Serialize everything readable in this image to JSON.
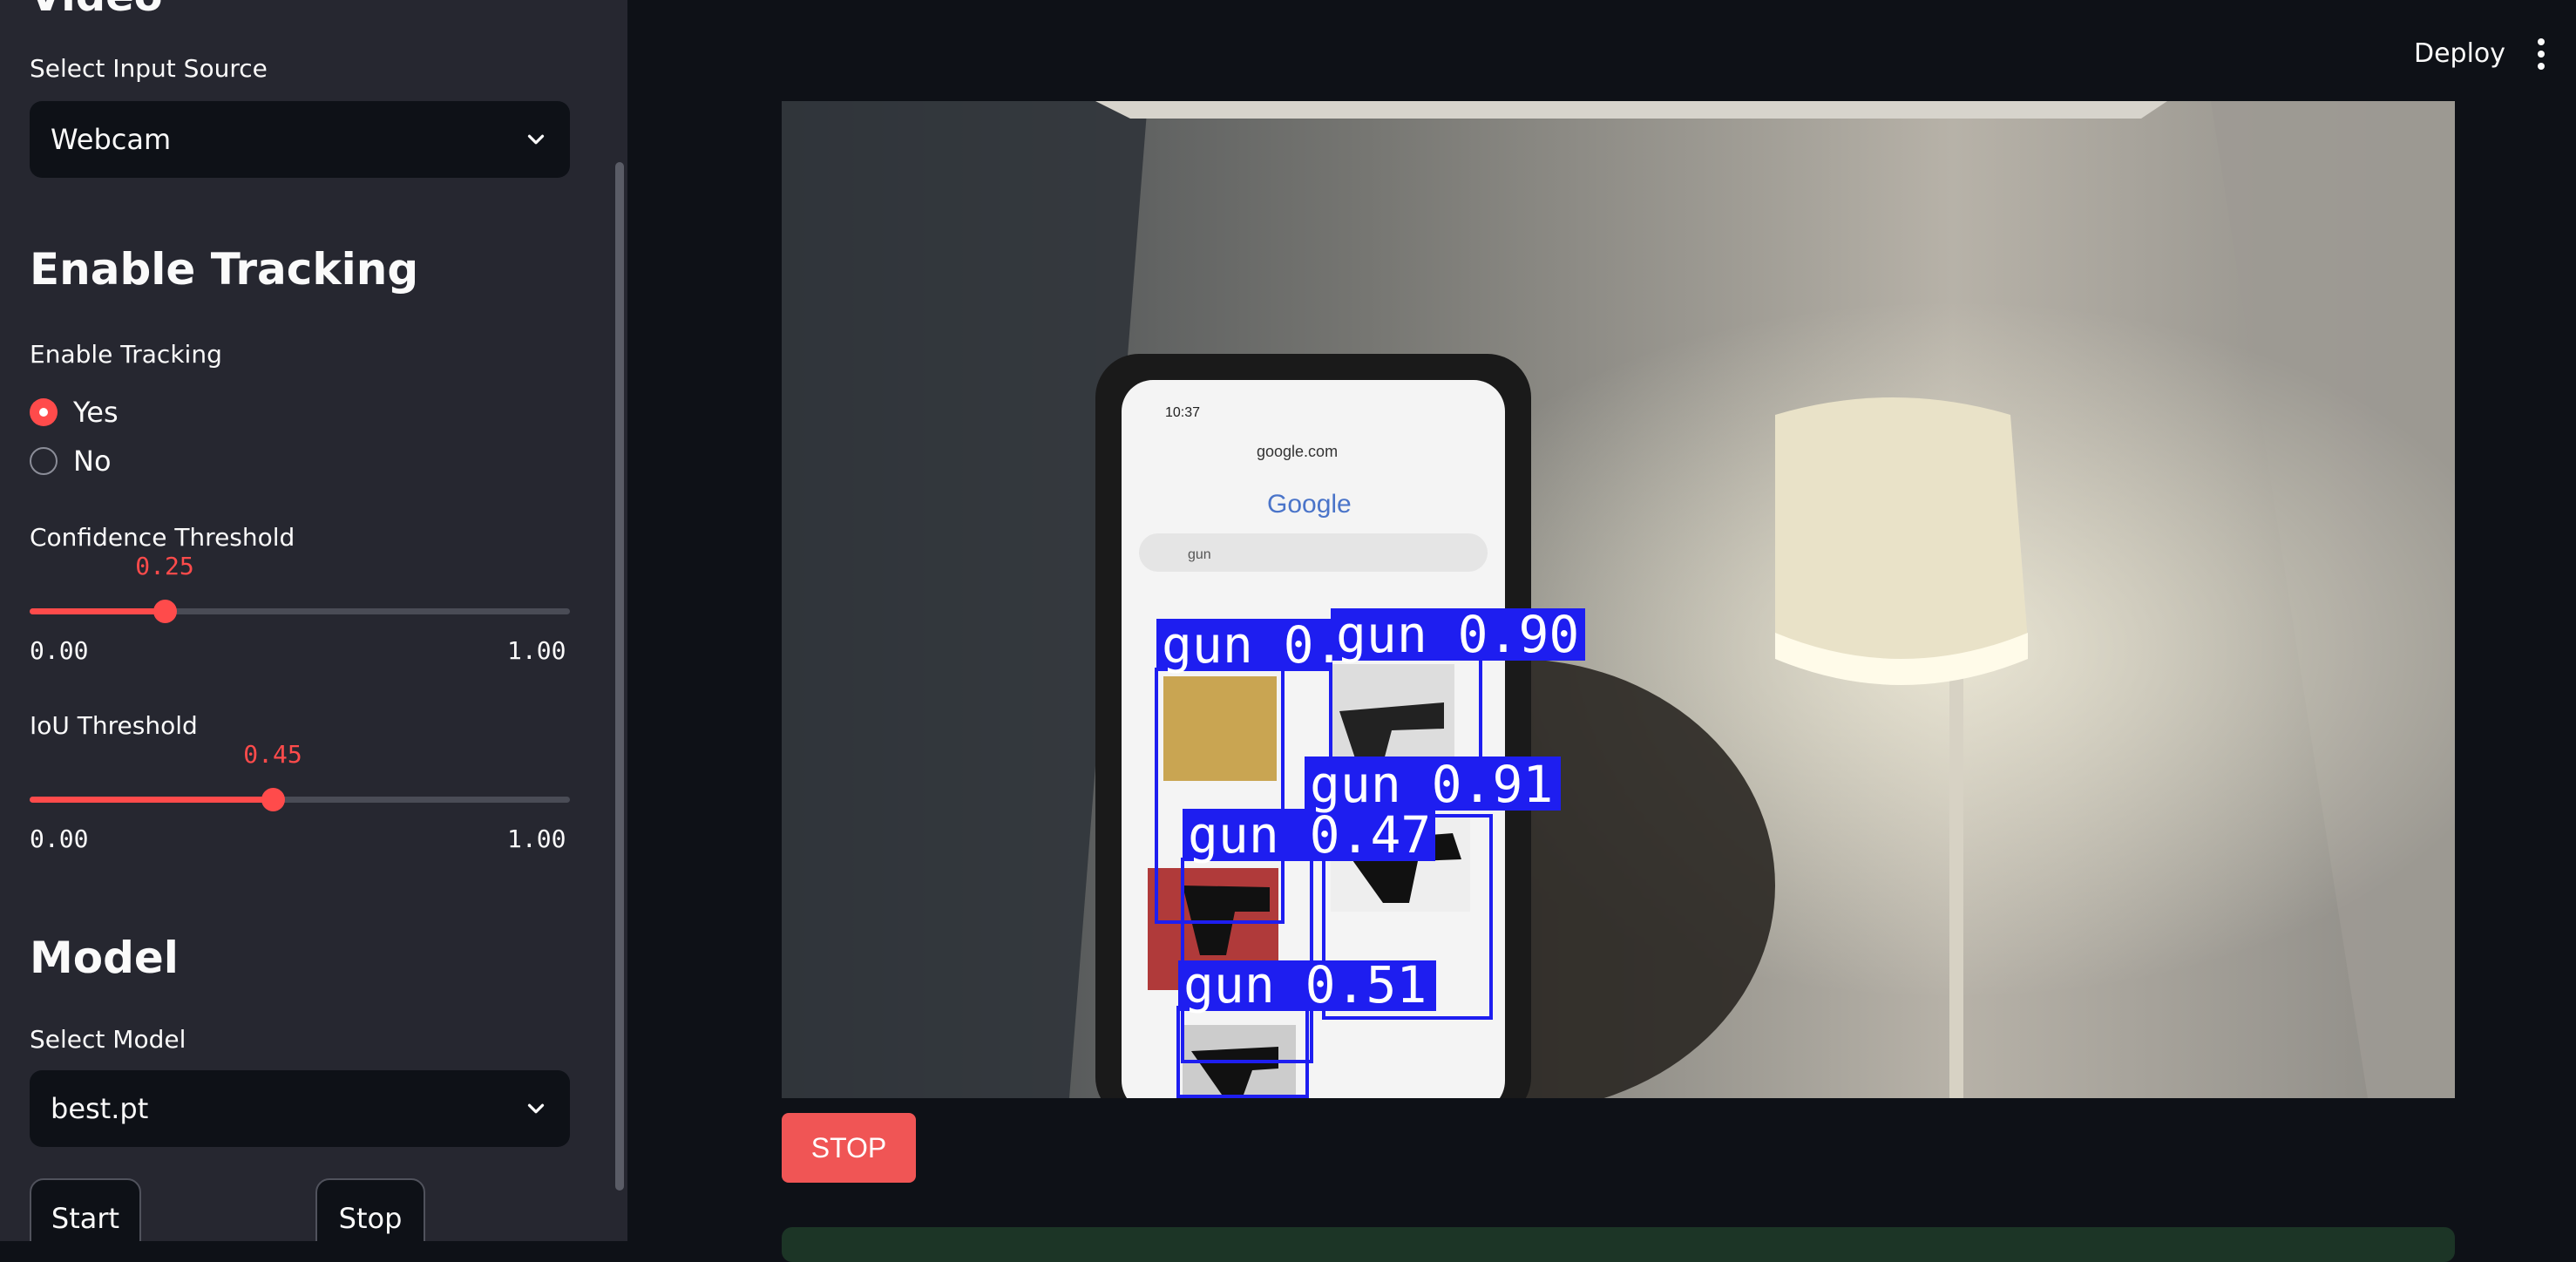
{
  "sidebar": {
    "partial_heading": "Video",
    "input_source": {
      "label": "Select Input Source",
      "value": "Webcam"
    },
    "tracking_heading": "Enable Tracking",
    "tracking": {
      "label": "Enable Tracking",
      "options": [
        "Yes",
        "No"
      ],
      "selected": "Yes"
    },
    "confidence": {
      "label": "Confidence Threshold",
      "value": "0.25",
      "fraction": 0.25,
      "min": "0.00",
      "max": "1.00"
    },
    "iou": {
      "label": "IoU Threshold",
      "value": "0.45",
      "fraction": 0.45,
      "min": "0.00",
      "max": "1.00"
    },
    "model_heading": "Model",
    "model": {
      "label": "Select Model",
      "value": "best.pt"
    },
    "start_label": "Start",
    "stop_label": "Stop"
  },
  "header": {
    "deploy_label": "Deploy"
  },
  "video": {
    "phone_time": "10:37",
    "phone_url": "google.com",
    "phone_logo": "Google",
    "phone_query": "gun",
    "detections": [
      {
        "label": "gun 0."
      },
      {
        "label": "gun 0.90"
      },
      {
        "label": "gun 0.91"
      },
      {
        "label": "gun 0.47"
      },
      {
        "label": "gun 0.51"
      }
    ]
  },
  "main": {
    "stop_label": "STOP"
  },
  "colors": {
    "accent": "#ff4b4b",
    "detection_box": "#1e1ef0",
    "background": "#0e1117",
    "sidebar": "#262730"
  }
}
